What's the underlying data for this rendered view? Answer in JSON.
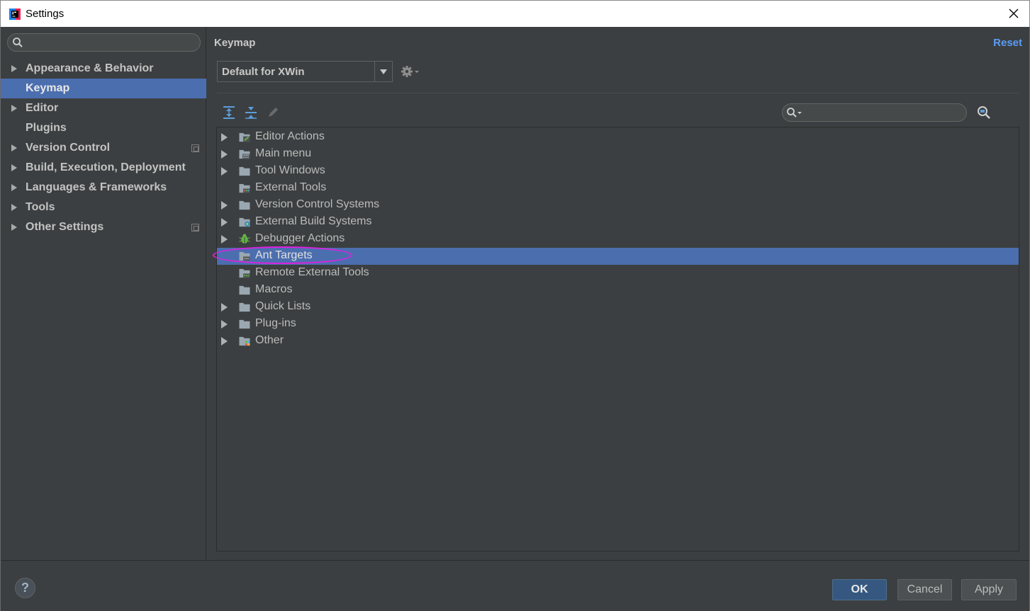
{
  "window": {
    "title": "Settings"
  },
  "sidebar": {
    "search_placeholder": "",
    "items": [
      {
        "label": "Appearance & Behavior",
        "expandable": true,
        "selected": false,
        "project_icon": false
      },
      {
        "label": "Keymap",
        "expandable": false,
        "selected": true,
        "project_icon": false
      },
      {
        "label": "Editor",
        "expandable": true,
        "selected": false,
        "project_icon": false
      },
      {
        "label": "Plugins",
        "expandable": false,
        "selected": false,
        "project_icon": false
      },
      {
        "label": "Version Control",
        "expandable": true,
        "selected": false,
        "project_icon": true
      },
      {
        "label": "Build, Execution, Deployment",
        "expandable": true,
        "selected": false,
        "project_icon": false
      },
      {
        "label": "Languages & Frameworks",
        "expandable": true,
        "selected": false,
        "project_icon": false
      },
      {
        "label": "Tools",
        "expandable": true,
        "selected": false,
        "project_icon": false
      },
      {
        "label": "Other Settings",
        "expandable": true,
        "selected": false,
        "project_icon": true
      }
    ]
  },
  "main": {
    "title": "Keymap",
    "reset_label": "Reset",
    "keymap_value": "Default for XWin",
    "filter_placeholder": "",
    "tree": [
      {
        "label": "Editor Actions",
        "expandable": true,
        "selected": false,
        "icon": "editor-actions-folder-icon"
      },
      {
        "label": "Main menu",
        "expandable": true,
        "selected": false,
        "icon": "main-menu-folder-icon"
      },
      {
        "label": "Tool Windows",
        "expandable": true,
        "selected": false,
        "icon": "folder-icon"
      },
      {
        "label": "External Tools",
        "expandable": false,
        "selected": false,
        "icon": "external-tools-folder-icon"
      },
      {
        "label": "Version Control Systems",
        "expandable": true,
        "selected": false,
        "icon": "folder-icon"
      },
      {
        "label": "External Build Systems",
        "expandable": true,
        "selected": false,
        "icon": "build-systems-folder-icon"
      },
      {
        "label": "Debugger Actions",
        "expandable": true,
        "selected": false,
        "icon": "bug-icon"
      },
      {
        "label": "Ant Targets",
        "expandable": false,
        "selected": true,
        "icon": "ant-folder-icon"
      },
      {
        "label": "Remote External Tools",
        "expandable": false,
        "selected": false,
        "icon": "remote-tools-folder-icon"
      },
      {
        "label": "Macros",
        "expandable": false,
        "selected": false,
        "icon": "folder-icon"
      },
      {
        "label": "Quick Lists",
        "expandable": true,
        "selected": false,
        "icon": "folder-icon"
      },
      {
        "label": "Plug-ins",
        "expandable": true,
        "selected": false,
        "icon": "folder-icon"
      },
      {
        "label": "Other",
        "expandable": true,
        "selected": false,
        "icon": "other-folder-icon"
      }
    ]
  },
  "buttons": {
    "help": "?",
    "ok": "OK",
    "cancel": "Cancel",
    "apply": "Apply"
  },
  "colors": {
    "background": "#3c3f41",
    "selection": "#4b6eaf",
    "link": "#589df6",
    "annotation": "#e020e0"
  }
}
